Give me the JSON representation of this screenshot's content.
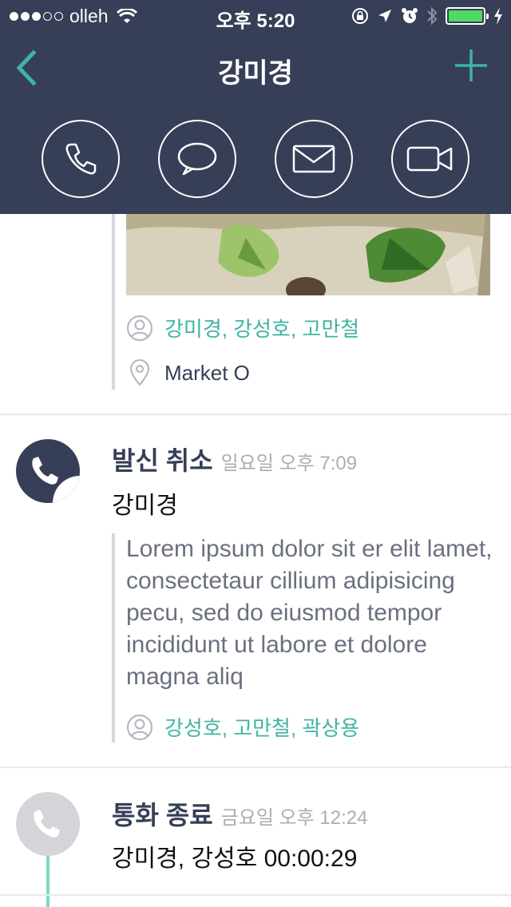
{
  "status_bar": {
    "carrier": "olleh",
    "time": "오후 5:20",
    "battery_level": 1.0
  },
  "nav": {
    "title": "강미경",
    "back_icon": "chevron-left-icon",
    "add_icon": "plus-icon"
  },
  "actions": [
    {
      "icon": "phone-icon"
    },
    {
      "icon": "chat-bubble-icon"
    },
    {
      "icon": "envelope-icon"
    },
    {
      "icon": "video-camera-icon"
    }
  ],
  "entries": {
    "photo_entry": {
      "participants": "강미경, 강성호, 고만철",
      "location": "Market O"
    },
    "canceled_call": {
      "type": "발신 취소",
      "time": "일요일 오후 7:09",
      "names": "강미경",
      "memo": "Lorem ipsum dolor sit er elit lamet, consectetaur cillium adipisicing pecu, sed do eiusmod tempor incididunt ut labore et dolore magna aliq",
      "participants": "강성호, 고만철, 곽상용"
    },
    "ended_call": {
      "type": "통화 종료",
      "time": "금요일 오후 12:24",
      "names": "강미경, 강성호 00:00:29"
    }
  },
  "colors": {
    "header_bg": "#363f57",
    "accent": "#3fb4a4",
    "text_muted": "#a9adb5",
    "timeline": "#7fd8c8"
  }
}
